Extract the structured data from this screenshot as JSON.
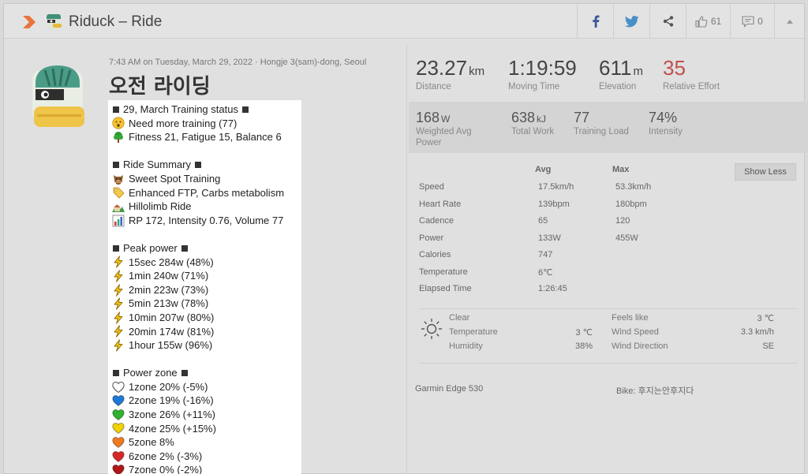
{
  "header": {
    "title": "Riduck – Ride",
    "like_count": "61",
    "comment_count": "0"
  },
  "activity": {
    "meta": "7:43 AM on Tuesday, March 29, 2022 · Hongje 3(sam)-dong, Seoul",
    "title": "오전 라이딩"
  },
  "description": {
    "training_status_heading": "29, March Training status",
    "training_need": "Need more training (77)",
    "training_fitness": "Fitness 21, Fatigue 15, Balance 6",
    "summary_heading": "Ride Summary",
    "summary_1": "Sweet Spot Training",
    "summary_2": "Enhanced FTP, Carbs metabolism",
    "summary_3": "Hillolimb Ride",
    "summary_4": "RP 172, Intensity 0.76, Volume 77",
    "peak_heading": "Peak power",
    "peak": [
      "15sec 284w (48%)",
      "1min 240w (71%)",
      "2min 223w (73%)",
      "5min 213w (78%)",
      "10min 207w (80%)",
      "20min 174w (81%)",
      "1hour 155w (96%)"
    ],
    "zone_heading": "Power zone",
    "zones": [
      "1zone 20% (-5%)",
      "2zone 19% (-16%)",
      "3zone 26% (+11%)",
      "4zone 25% (+15%)",
      "5zone 8%",
      "6zone 2% (-3%)",
      "7zone 0% (-2%)"
    ],
    "zone_colors": [
      "#ffffff",
      "#1e78d6",
      "#2fb32f",
      "#f2d200",
      "#f07a1e",
      "#d62828",
      "#b01818"
    ]
  },
  "primary_stats": {
    "distance": {
      "value": "23.27",
      "unit": "km",
      "label": "Distance"
    },
    "moving_time": {
      "value": "1:19:59",
      "label": "Moving Time"
    },
    "elevation": {
      "value": "611",
      "unit": "m",
      "label": "Elevation"
    },
    "relative_effort": {
      "value": "35",
      "label": "Relative Effort"
    }
  },
  "secondary_stats": {
    "weighted_power": {
      "value": "168",
      "unit": "W",
      "label_1": "Weighted Avg",
      "label_2": "Power"
    },
    "total_work": {
      "value": "638",
      "unit": "kJ",
      "label": "Total Work"
    },
    "training_load": {
      "value": "77",
      "label": "Training Load"
    },
    "intensity": {
      "value": "74%",
      "label": "Intensity"
    }
  },
  "details": {
    "avg_header": "Avg",
    "max_header": "Max",
    "show_less": "Show Less",
    "rows": [
      {
        "label": "Speed",
        "avg": "17.5km/h",
        "max": "53.3km/h"
      },
      {
        "label": "Heart Rate",
        "avg": "139bpm",
        "max": "180bpm"
      },
      {
        "label": "Cadence",
        "avg": "65",
        "max": "120"
      },
      {
        "label": "Power",
        "avg": "133W",
        "max": "455W"
      },
      {
        "label": "Calories",
        "avg": "747",
        "max": ""
      },
      {
        "label": "Temperature",
        "avg": "6℃",
        "max": ""
      },
      {
        "label": "Elapsed Time",
        "avg": "1:26:45",
        "max": ""
      }
    ]
  },
  "weather": {
    "condition": "Clear",
    "temperature_label": "Temperature",
    "temperature_value": "3 ℃",
    "humidity_label": "Humidity",
    "humidity_value": "38%",
    "feels_like_label": "Feels like",
    "feels_like_value": "3 ℃",
    "wind_speed_label": "Wind Speed",
    "wind_speed_value": "3.3 km/h",
    "wind_direction_label": "Wind Direction",
    "wind_direction_value": "SE"
  },
  "footer": {
    "device": "Garmin Edge 530",
    "bike": "Bike: 후지는안후지다"
  },
  "colors": {
    "accent": "#e8743b",
    "relative_effort": "#c0504d",
    "facebook": "#3b5998",
    "twitter": "#4a90c8"
  }
}
